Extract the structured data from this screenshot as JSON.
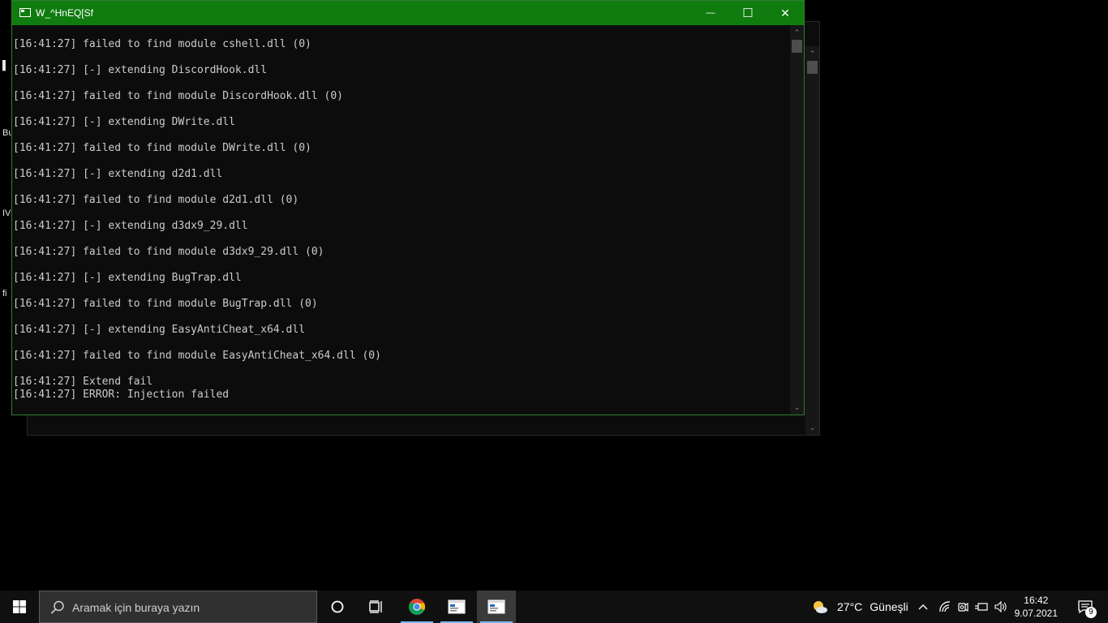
{
  "desktop": {
    "fragments": [
      "Bu",
      "IV",
      "fi"
    ]
  },
  "window": {
    "title": "W_^HnEQ[Sf",
    "minimize_glyph": "—",
    "maximize_glyph": "☐",
    "close_glyph": "✕",
    "lines": [
      "[16:41:27] failed to find module cshell.dll (0)",
      "",
      "[16:41:27] [-] extending DiscordHook.dll",
      "",
      "[16:41:27] failed to find module DiscordHook.dll (0)",
      "",
      "[16:41:27] [-] extending DWrite.dll",
      "",
      "[16:41:27] failed to find module DWrite.dll (0)",
      "",
      "[16:41:27] [-] extending d2d1.dll",
      "",
      "[16:41:27] failed to find module d2d1.dll (0)",
      "",
      "[16:41:27] [-] extending d3dx9_29.dll",
      "",
      "[16:41:27] failed to find module d3dx9_29.dll (0)",
      "",
      "[16:41:27] [-] extending BugTrap.dll",
      "",
      "[16:41:27] failed to find module BugTrap.dll (0)",
      "",
      "[16:41:27] [-] extending EasyAntiCheat_x64.dll",
      "",
      "[16:41:27] failed to find module EasyAntiCheat_x64.dll (0)",
      "",
      "[16:41:27] Extend fail",
      "[16:41:27] ERROR: Injection failed"
    ]
  },
  "taskbar": {
    "search_placeholder": "Aramak için buraya yazın",
    "weather_temp": "27°C",
    "weather_desc": "Güneşli",
    "time": "16:42",
    "date": "9.07.2021",
    "notification_count": "9",
    "colors": {
      "accent": "#107c10",
      "taskbar": "#101010",
      "active_underline": "#76b9ed"
    }
  }
}
